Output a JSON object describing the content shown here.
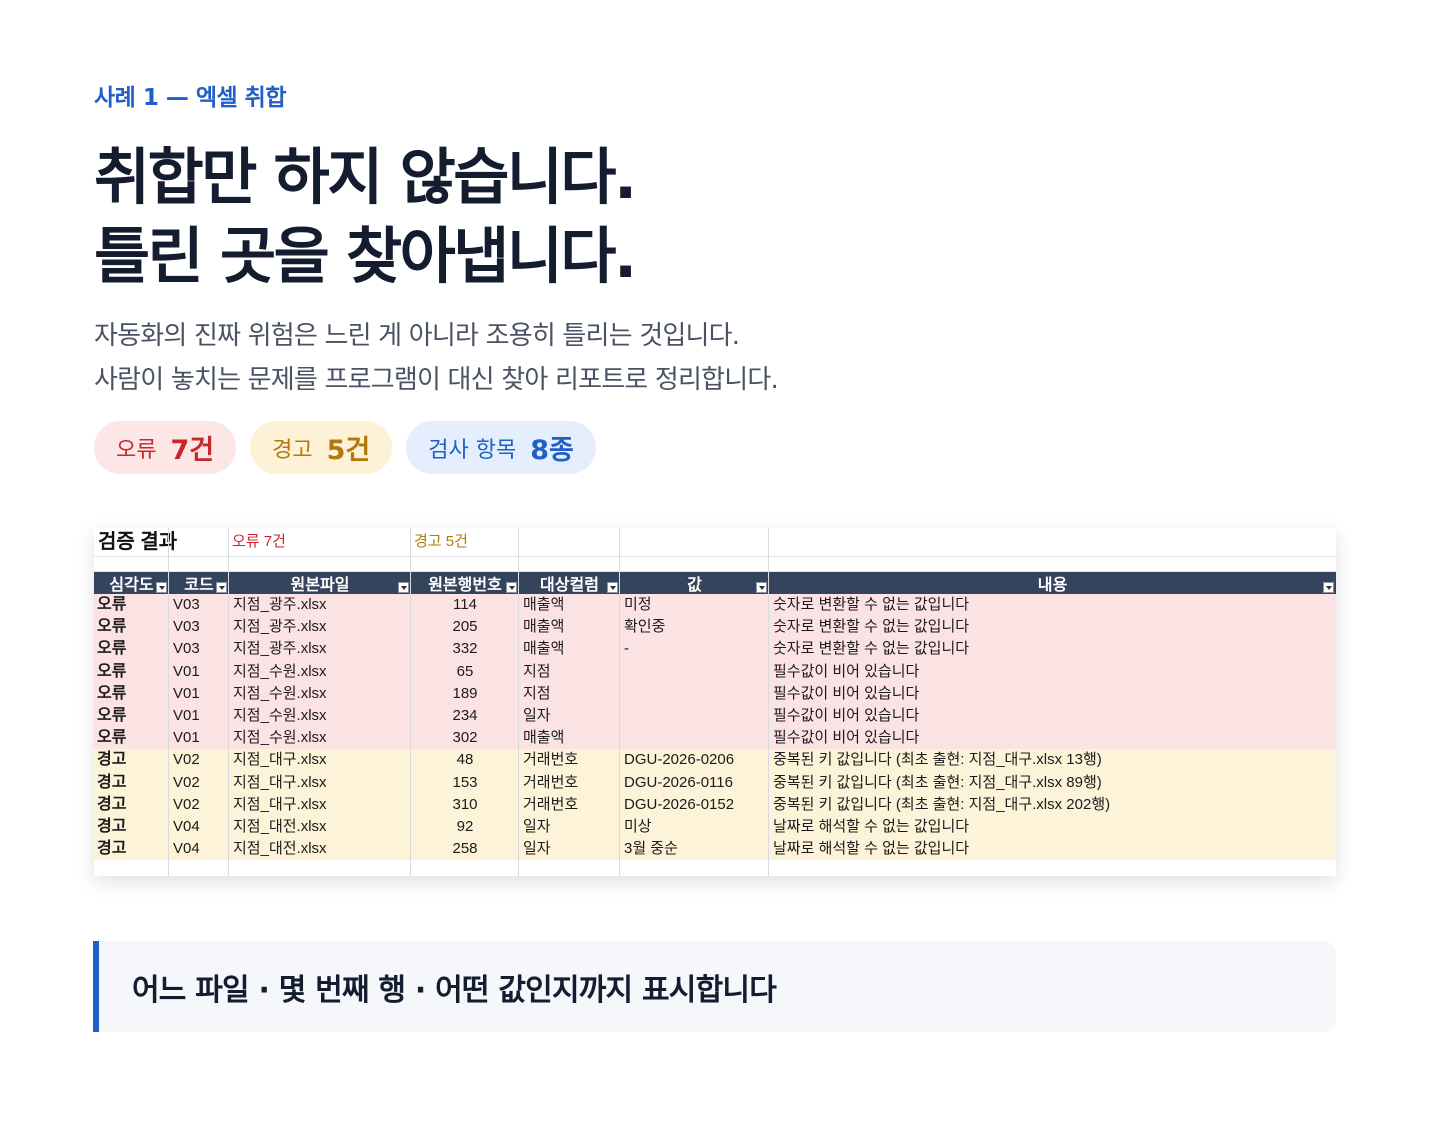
{
  "eyebrow": "사례 1 — 엑셀 취합",
  "title": [
    "취합만 하지 않습니다.",
    "틀린 곳을 찾아냅니다."
  ],
  "subtitle": [
    "자동화의 진짜 위험은 느린 게 아니라 조용히 틀리는 것입니다.",
    "사람이 놓치는 문제를 프로그램이 대신 찾아 리포트로 정리합니다."
  ],
  "badges": [
    {
      "label": "오류",
      "value": "7건",
      "tone": "red"
    },
    {
      "label": "경고",
      "value": "5건",
      "tone": "yellow"
    },
    {
      "label": "검사 항목",
      "value": "8종",
      "tone": "blue"
    }
  ],
  "sheet": {
    "summary": {
      "title": "검증 결과",
      "errors": "오류 7건",
      "warnings": "경고 5건"
    },
    "columns": [
      "심각도",
      "코드",
      "원본파일",
      "원본행번호",
      "대상컬럼",
      "값",
      "내용"
    ],
    "rows": [
      {
        "sev": "오류",
        "code": "V03",
        "file": "지점_광주.xlsx",
        "row": "114",
        "col": "매출액",
        "value": "미정",
        "msg": "숫자로 변환할 수 없는 값입니다"
      },
      {
        "sev": "오류",
        "code": "V03",
        "file": "지점_광주.xlsx",
        "row": "205",
        "col": "매출액",
        "value": "확인중",
        "msg": "숫자로 변환할 수 없는 값입니다"
      },
      {
        "sev": "오류",
        "code": "V03",
        "file": "지점_광주.xlsx",
        "row": "332",
        "col": "매출액",
        "value": "-",
        "msg": "숫자로 변환할 수 없는 값입니다"
      },
      {
        "sev": "오류",
        "code": "V01",
        "file": "지점_수원.xlsx",
        "row": "65",
        "col": "지점",
        "value": "",
        "msg": "필수값이 비어 있습니다"
      },
      {
        "sev": "오류",
        "code": "V01",
        "file": "지점_수원.xlsx",
        "row": "189",
        "col": "지점",
        "value": "",
        "msg": "필수값이 비어 있습니다"
      },
      {
        "sev": "오류",
        "code": "V01",
        "file": "지점_수원.xlsx",
        "row": "234",
        "col": "일자",
        "value": "",
        "msg": "필수값이 비어 있습니다"
      },
      {
        "sev": "오류",
        "code": "V01",
        "file": "지점_수원.xlsx",
        "row": "302",
        "col": "매출액",
        "value": "",
        "msg": "필수값이 비어 있습니다"
      },
      {
        "sev": "경고",
        "code": "V02",
        "file": "지점_대구.xlsx",
        "row": "48",
        "col": "거래번호",
        "value": "DGU-2026-0206",
        "msg": "중복된 키 값입니다 (최초 출현: 지점_대구.xlsx 13행)"
      },
      {
        "sev": "경고",
        "code": "V02",
        "file": "지점_대구.xlsx",
        "row": "153",
        "col": "거래번호",
        "value": "DGU-2026-0116",
        "msg": "중복된 키 값입니다 (최초 출현: 지점_대구.xlsx 89행)"
      },
      {
        "sev": "경고",
        "code": "V02",
        "file": "지점_대구.xlsx",
        "row": "310",
        "col": "거래번호",
        "value": "DGU-2026-0152",
        "msg": "중복된 키 값입니다 (최초 출현: 지점_대구.xlsx 202행)"
      },
      {
        "sev": "경고",
        "code": "V04",
        "file": "지점_대전.xlsx",
        "row": "92",
        "col": "일자",
        "value": "미상",
        "msg": "날짜로 해석할 수 없는 값입니다"
      },
      {
        "sev": "경고",
        "code": "V04",
        "file": "지점_대전.xlsx",
        "row": "258",
        "col": "일자",
        "value": "3월 중순",
        "msg": "날짜로 해석할 수 없는 값입니다"
      }
    ]
  },
  "callout": "어느 파일 · 몇 번째 행 · 어떤 값인지까지 표시합니다",
  "colors": {
    "accent": "#1f5fc7",
    "error": "#c8282c",
    "warning": "#b07a0a",
    "header": "#34445c"
  }
}
